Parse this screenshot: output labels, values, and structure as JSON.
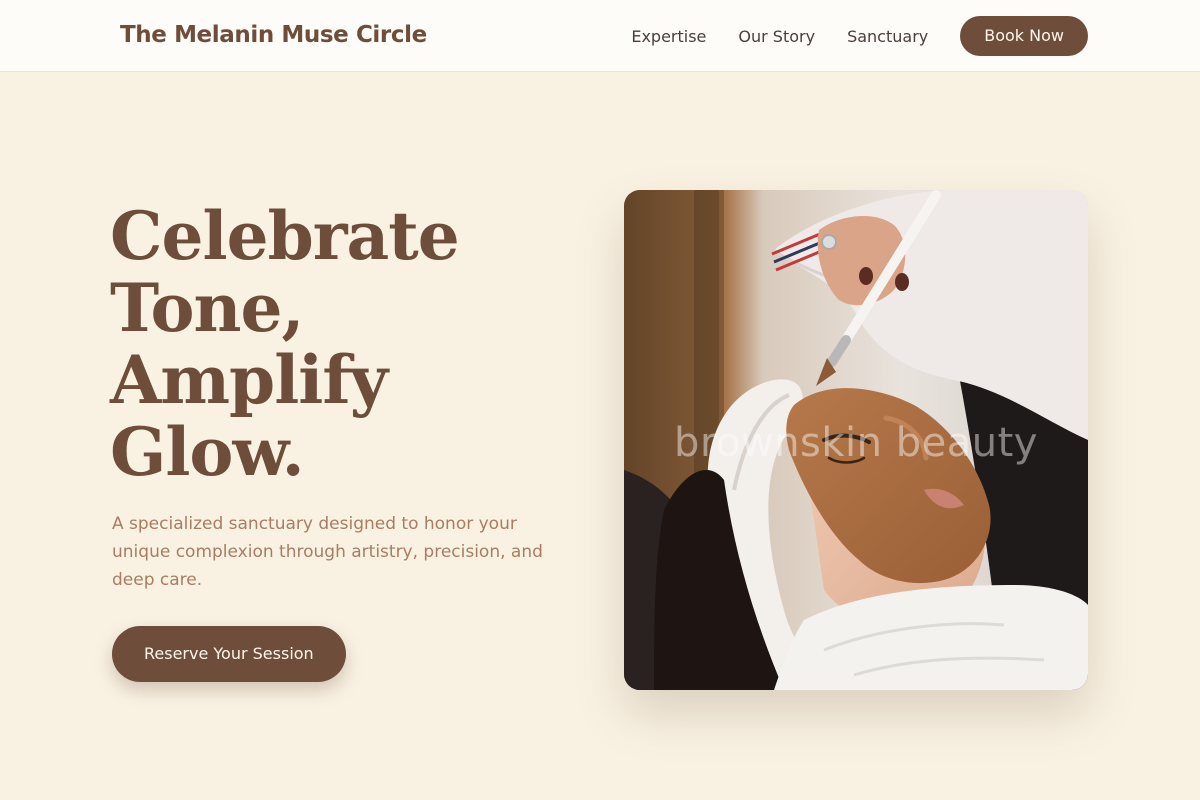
{
  "header": {
    "brand": "The Melanin Muse Circle",
    "nav": [
      "Expertise",
      "Our Story",
      "Sanctuary"
    ],
    "cta_label": "Book Now"
  },
  "hero": {
    "headline": [
      "Celebrate",
      "Tone,",
      "Amplify",
      "Glow."
    ],
    "subtext": "A specialized sanctuary designed to honor your unique complexion through artistry, precision, and deep care.",
    "cta_label": "Reserve Your Session",
    "image": {
      "description": "facial-treatment-photo",
      "watermark": "brownskin beauty"
    }
  },
  "colors": {
    "page_background": "#f9f2e2",
    "header_background": "#fefcf8",
    "brand": "#6e4d3a",
    "body_text": "#a97c63",
    "button_text": "#fdf6ea"
  }
}
